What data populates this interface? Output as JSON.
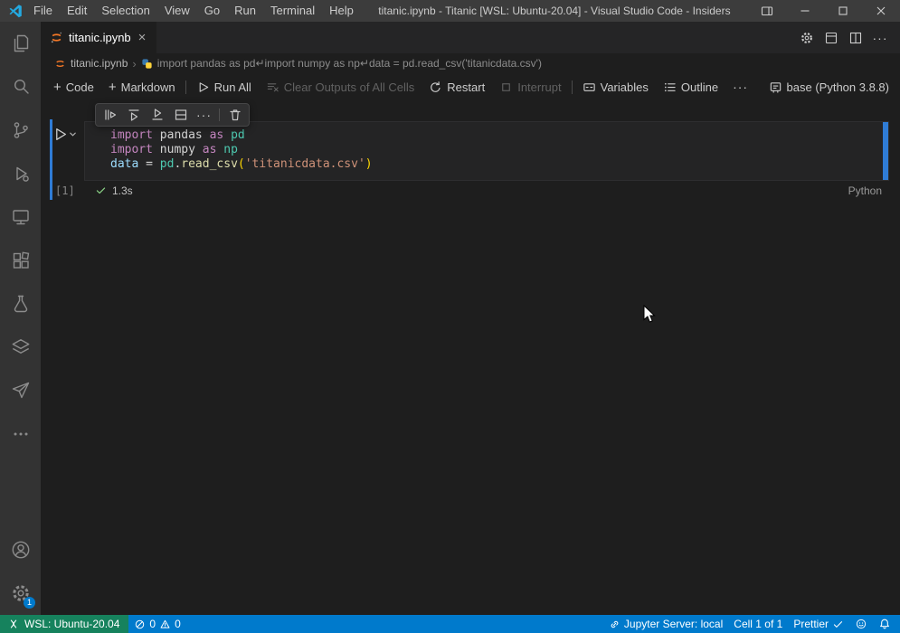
{
  "title_bar": {
    "menus": [
      "File",
      "Edit",
      "Selection",
      "View",
      "Go",
      "Run",
      "Terminal",
      "Help"
    ],
    "title": "titanic.ipynb - Titanic [WSL: Ubuntu-20.04] - Visual Studio Code - Insiders"
  },
  "tab_bar": {
    "tabs": [
      {
        "label": "titanic.ipynb"
      }
    ]
  },
  "breadcrumb": {
    "file": "titanic.ipynb",
    "separator": "›",
    "cell_text": "import pandas as pd↵import numpy as np↵data = pd.read_csv('titanicdata.csv')"
  },
  "notebook_toolbar": {
    "code": "Code",
    "markdown": "Markdown",
    "run_all": "Run All",
    "clear_outputs": "Clear Outputs of All Cells",
    "restart": "Restart",
    "interrupt": "Interrupt",
    "variables": "Variables",
    "outline": "Outline",
    "kernel": "base (Python 3.8.8)"
  },
  "cell": {
    "execution_count": "[1]",
    "duration": "1.3s",
    "language": "Python",
    "code_lines": [
      [
        {
          "t": "import ",
          "c": "keyword"
        },
        {
          "t": "pandas",
          "c": "plain"
        },
        {
          "t": " as ",
          "c": "keyword"
        },
        {
          "t": "pd",
          "c": "module"
        }
      ],
      [
        {
          "t": "import ",
          "c": "keyword"
        },
        {
          "t": "numpy",
          "c": "plain"
        },
        {
          "t": " as ",
          "c": "keyword"
        },
        {
          "t": "np",
          "c": "module"
        }
      ],
      [
        {
          "t": "data",
          "c": "variable"
        },
        {
          "t": " = ",
          "c": "plain"
        },
        {
          "t": "pd",
          "c": "module"
        },
        {
          "t": ".",
          "c": "plain"
        },
        {
          "t": "read_csv",
          "c": "function"
        },
        {
          "t": "(",
          "c": "bracket"
        },
        {
          "t": "'titanicdata.csv'",
          "c": "string"
        },
        {
          "t": ")",
          "c": "bracket"
        }
      ]
    ]
  },
  "status_bar": {
    "remote": "WSL: Ubuntu-20.04",
    "errors": "0",
    "warnings": "0",
    "jupyter_server": "Jupyter Server: local",
    "cell_position": "Cell 1 of 1",
    "formatter": "Prettier"
  },
  "activity_bar": {
    "items": [
      "explorer",
      "search",
      "source-control",
      "run-and-debug",
      "remote-explorer",
      "extensions",
      "testing",
      "layers",
      "send",
      "more"
    ],
    "bottom_items": [
      "account",
      "settings"
    ],
    "settings_badge": "1"
  },
  "icons": {
    "more": "···",
    "plus": "+",
    "close": "×"
  },
  "colors": {
    "status_bar": "#007acc",
    "remote_indicator": "#16825d",
    "focus_bar": "#2f7cd6",
    "badge": "#007acc",
    "jupyter_orange": "#f37726",
    "syntax": {
      "keyword": "#c586c0",
      "plain": "#d4d4d4",
      "module": "#4ec9b0",
      "variable": "#9cdcfe",
      "function": "#dcdcaa",
      "string": "#ce9178",
      "bracket": "#ffd700"
    }
  }
}
